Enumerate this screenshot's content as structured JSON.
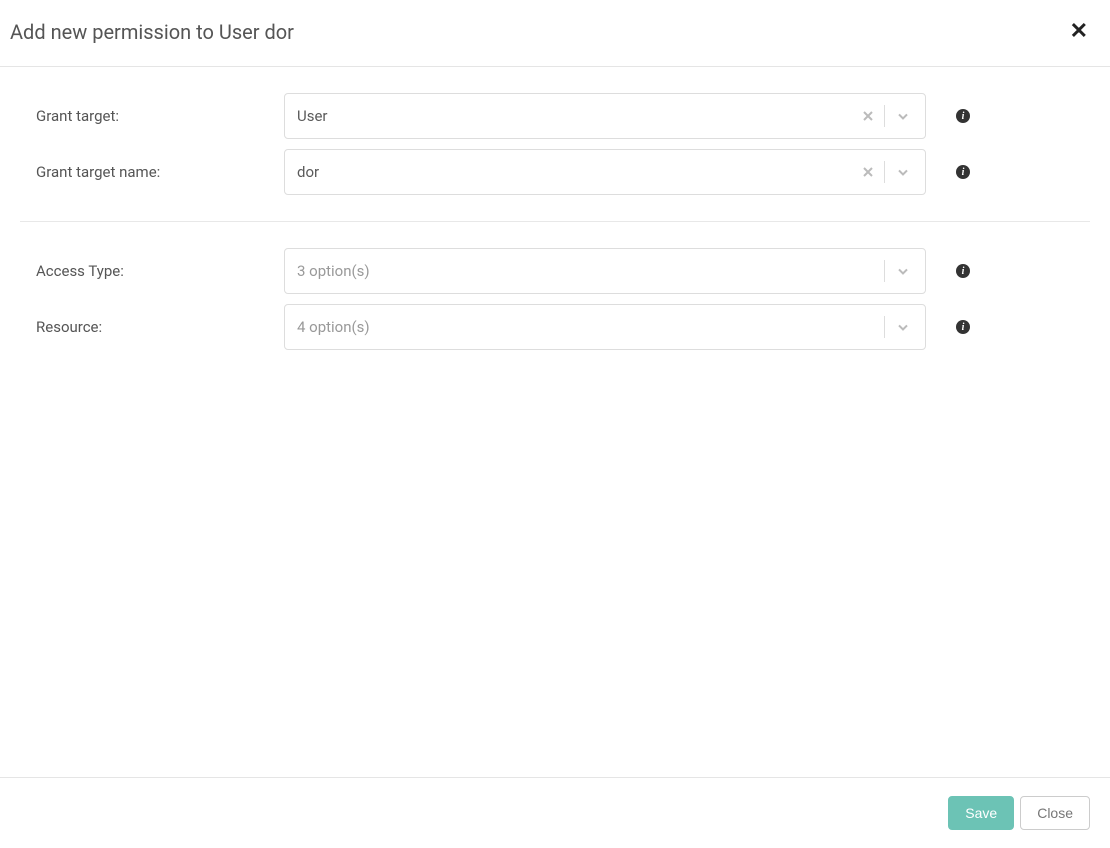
{
  "header": {
    "title": "Add new permission to User dor"
  },
  "form": {
    "grant_target": {
      "label": "Grant target:",
      "value": "User"
    },
    "grant_target_name": {
      "label": "Grant target name:",
      "value": "dor"
    },
    "access_type": {
      "label": "Access Type:",
      "placeholder": "3 option(s)"
    },
    "resource": {
      "label": "Resource:",
      "placeholder": "4 option(s)"
    }
  },
  "footer": {
    "save_label": "Save",
    "close_label": "Close"
  },
  "icons": {
    "info": "i"
  }
}
